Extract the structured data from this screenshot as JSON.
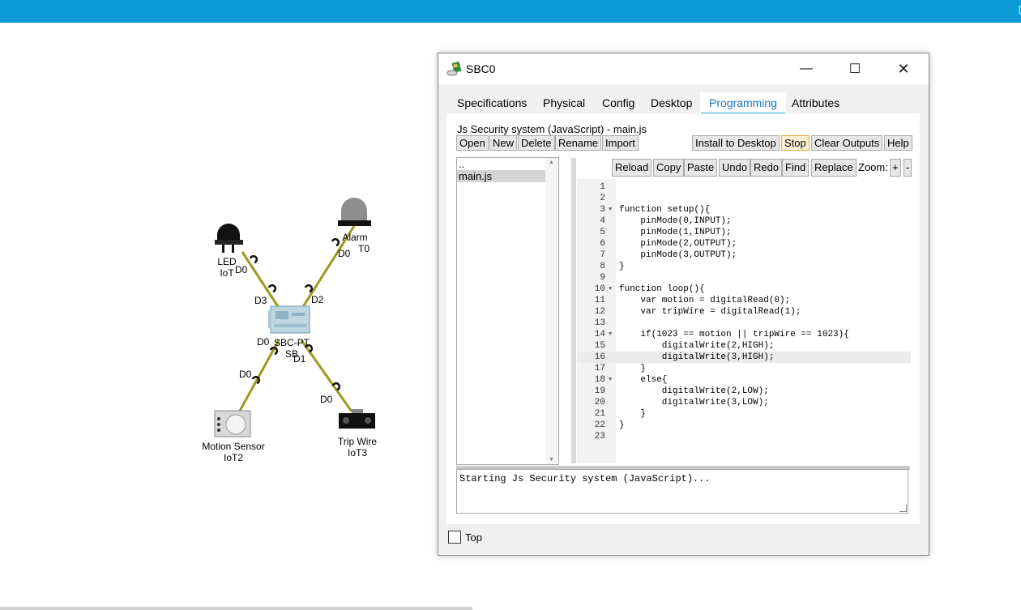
{
  "topbar": {
    "mark": "["
  },
  "workspace": {
    "devices": [
      {
        "name": "LED",
        "label": "LED",
        "sublabel": "IoT"
      },
      {
        "name": "Alarm",
        "label": "Alarm",
        "sublabel": "T0"
      },
      {
        "name": "SBC",
        "label": "SBC-PT",
        "sublabel": "SB"
      },
      {
        "name": "Motion Sensor",
        "label": "Motion Sensor",
        "sublabel": "IoT2"
      },
      {
        "name": "Trip Wire",
        "label": "Trip Wire",
        "sublabel": "IoT3"
      }
    ],
    "port_labels": {
      "led_d0": "D0",
      "sbc_d3": "D3",
      "alarm_d0": "D0",
      "sbc_d2": "D2",
      "sbc_d0": "D0",
      "sbc_d1": "D1",
      "motion_d0": "D0",
      "trip_d0": "D0"
    }
  },
  "window": {
    "title": "SBC0",
    "controls": {
      "minimize": "—",
      "maximize": "☐",
      "close": "✕"
    },
    "tabs": [
      "Specifications",
      "Physical",
      "Config",
      "Desktop",
      "Programming",
      "Attributes"
    ],
    "active_tab": "Programming",
    "project_title": "Js Security system (JavaScript) - main.js",
    "buttons": {
      "open": "Open",
      "new": "New",
      "delete": "Delete",
      "rename": "Rename",
      "import": "Import",
      "install": "Install to Desktop",
      "stop": "Stop",
      "clear": "Clear Outputs",
      "help": "Help"
    },
    "files": [
      "..",
      "main.js"
    ],
    "selected_file": "main.js",
    "editor_toolbar": {
      "reload": "Reload",
      "copy": "Copy",
      "paste": "Paste",
      "undo": "Undo",
      "redo": "Redo",
      "find": "Find",
      "replace": "Replace",
      "zoom_label": "Zoom:",
      "zoom_in": "+",
      "zoom_out": "-"
    },
    "code_lines": [
      "",
      "",
      "function setup(){",
      "    pinMode(0,INPUT);",
      "    pinMode(1,INPUT);",
      "    pinMode(2,OUTPUT);",
      "    pinMode(3,OUTPUT);",
      "}",
      "",
      "function loop(){",
      "    var motion = digitalRead(0);",
      "    var tripWire = digitalRead(1);",
      "",
      "    if(1023 == motion || tripWire == 1023){",
      "        digitalWrite(2,HIGH);",
      "        digitalWrite(3,HIGH);",
      "    }",
      "    else{",
      "        digitalWrite(2,LOW);",
      "        digitalWrite(3,LOW);",
      "    }",
      "}",
      ""
    ],
    "current_line": 16,
    "fold_lines": [
      3,
      10,
      14,
      18
    ],
    "output_text": "Starting Js Security system (JavaScript)...",
    "top_checkbox_label": "Top",
    "top_checked": false
  },
  "colors": {
    "topbar": "#0b9bd6",
    "active_tab": "#1a72bf",
    "wire": "#9c9a1c"
  }
}
